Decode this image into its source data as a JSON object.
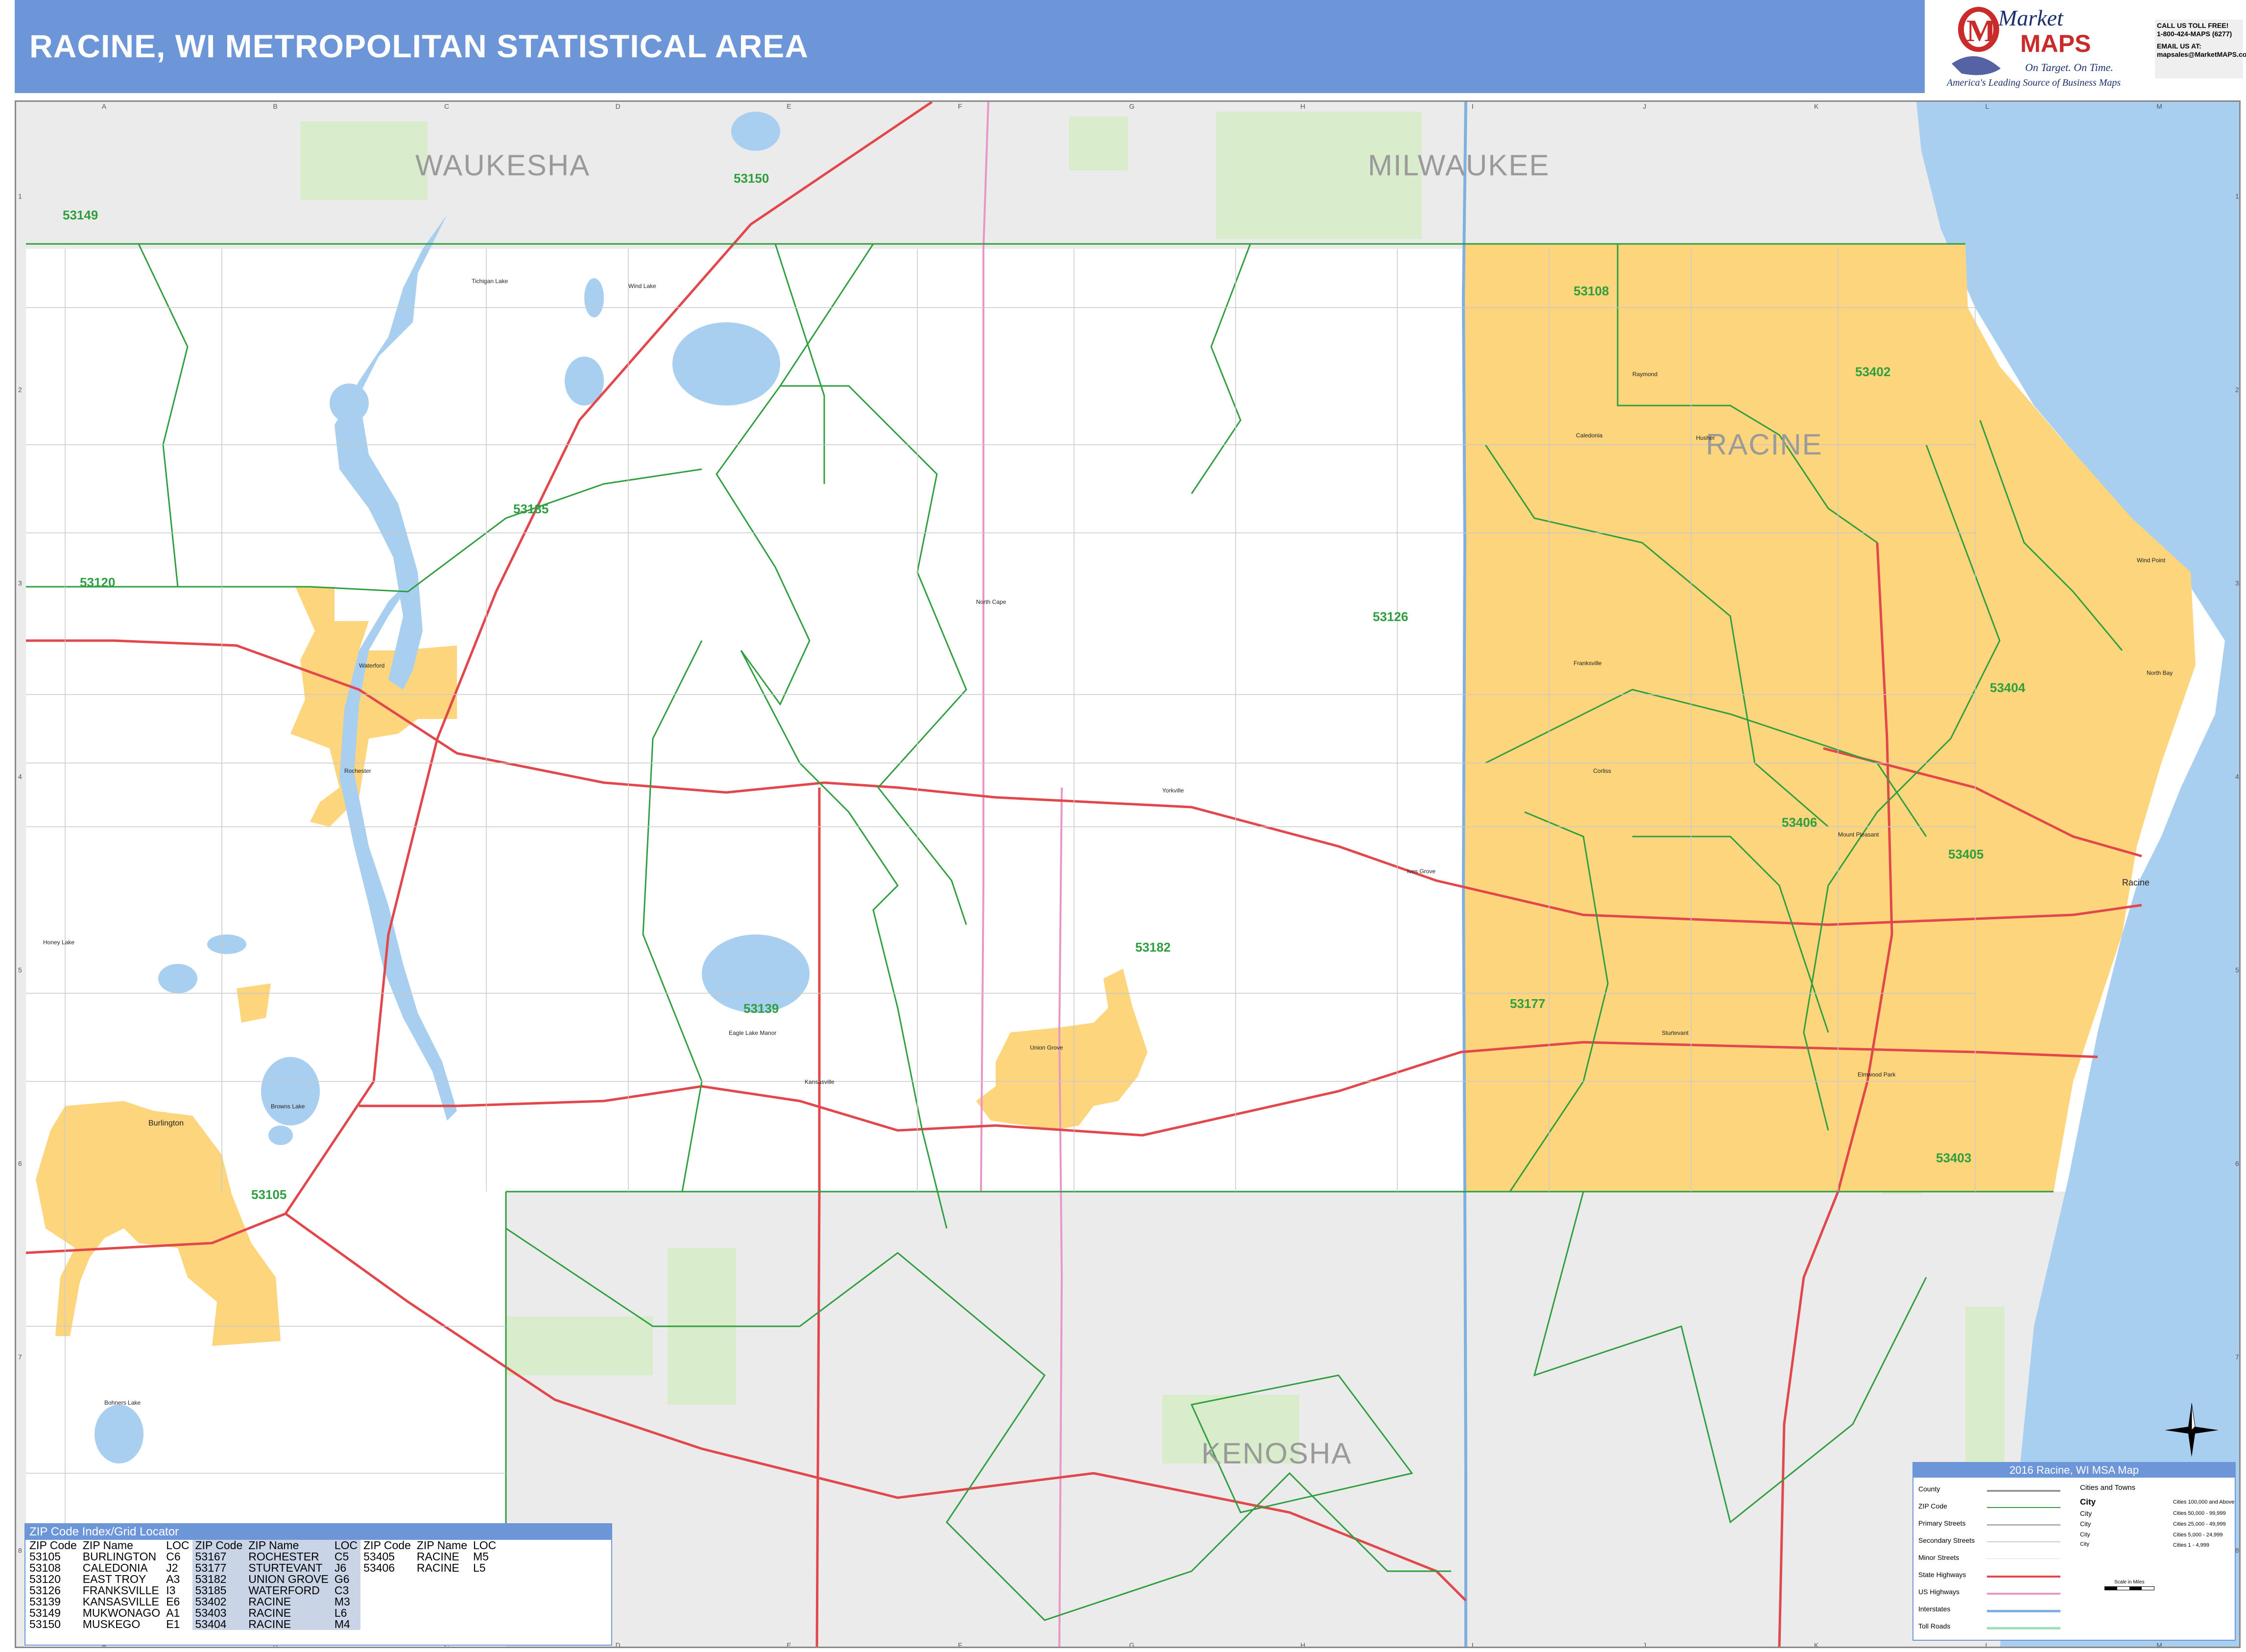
{
  "header": {
    "title": "RACINE, WI METROPOLITAN STATISTICAL AREA"
  },
  "brand": {
    "logo_word1": "Market",
    "logo_word2": "MAPS",
    "tagline": "On Target. On Time.",
    "subtagline": "America's Leading Source of Business Maps",
    "call_line1": "CALL US TOLL FREE!",
    "call_line2": "1-800-424-MAPS (6277)",
    "email_line1": "EMAIL US AT:",
    "email_line2": "mapsales@MarketMAPS.com"
  },
  "map": {
    "county_labels": [
      "WAUKESHA",
      "MILWAUKEE",
      "RACINE",
      "KENOSHA"
    ],
    "grid_columns": [
      "A",
      "B",
      "C",
      "D",
      "E",
      "F",
      "G",
      "H",
      "I",
      "J",
      "K",
      "L",
      "M"
    ],
    "grid_rows": [
      "1",
      "2",
      "3",
      "4",
      "5",
      "6",
      "7",
      "8"
    ],
    "zip_labels": [
      "53149",
      "53150",
      "53108",
      "53402",
      "53185",
      "53120",
      "53126",
      "53404",
      "53406",
      "53405",
      "53182",
      "53139",
      "53177",
      "53403",
      "53105"
    ],
    "place_labels": [
      "Racine",
      "Sturtevant",
      "Union Grove",
      "Kansasville",
      "Eagle Lake Manor",
      "North Cape",
      "Caledonia",
      "Franksville",
      "Waterford",
      "Wind Lake",
      "Tichigan Lake",
      "Rochester",
      "Yorkville",
      "Mount Pleasant",
      "Elmwood Park",
      "Wind Point",
      "North Bay",
      "Browns Lake",
      "Bohners Lake",
      "Honey Lake",
      "Raymond",
      "Corliss",
      "Husher",
      "Burlington",
      "Ives Grove"
    ],
    "colors": {
      "county_shade": "#ebebeb",
      "city_fill": "#fdd57c",
      "water": "#a8cff0",
      "park": "#d9eccb",
      "zip_line": "#2e9e3e",
      "state_highway": "#e2474b",
      "us_highway": "#e896c8",
      "interstate": "#7fb0e0"
    }
  },
  "zip_index": {
    "title": "ZIP Code Index/Grid Locator",
    "headers": [
      "ZIP Code",
      "ZIP Name",
      "LOC",
      "ZIP Code",
      "ZIP Name",
      "LOC",
      "ZIP Code",
      "ZIP Name",
      "LOC"
    ],
    "rows": [
      [
        "53105",
        "BURLINGTON",
        "C6",
        "53167",
        "ROCHESTER",
        "C5",
        "53405",
        "RACINE",
        "M5"
      ],
      [
        "53108",
        "CALEDONIA",
        "J2",
        "53177",
        "STURTEVANT",
        "J6",
        "53406",
        "RACINE",
        "L5"
      ],
      [
        "53120",
        "EAST TROY",
        "A3",
        "53182",
        "UNION GROVE",
        "G6",
        "",
        "",
        ""
      ],
      [
        "53126",
        "FRANKSVILLE",
        "I3",
        "53185",
        "WATERFORD",
        "C3",
        "",
        "",
        ""
      ],
      [
        "53139",
        "KANSASVILLE",
        "E6",
        "53402",
        "RACINE",
        "M3",
        "",
        "",
        ""
      ],
      [
        "53149",
        "MUKWONAGO",
        "A1",
        "53403",
        "RACINE",
        "L6",
        "",
        "",
        ""
      ],
      [
        "53150",
        "MUSKEGO",
        "E1",
        "53404",
        "RACINE",
        "M4",
        "",
        "",
        ""
      ]
    ]
  },
  "legend": {
    "title": "2016 Racine, WI MSA Map",
    "items": [
      "County",
      "ZIP Code",
      "Primary Streets",
      "Secondary Streets",
      "Minor Streets",
      "State Highways",
      "US Highways",
      "Interstates",
      "Toll Roads"
    ],
    "cities_header": "Cities and Towns",
    "city_samples": [
      "City",
      "City",
      "City",
      "City",
      "City"
    ],
    "city_sizes": [
      "Cities 100,000 and Above",
      "Cities 50,000 - 99,999",
      "Cities 25,000 - 49,999",
      "Cities 5,000 - 24,999",
      "Cities 1 - 4,999"
    ],
    "scale_label": "Scale in Miles"
  }
}
